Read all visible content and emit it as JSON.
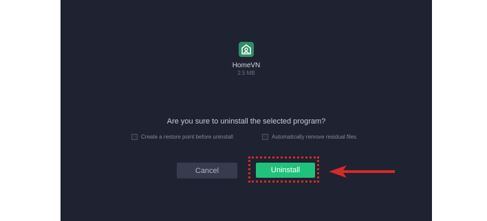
{
  "app": {
    "name": "HomeVN",
    "size": "2.5 MB",
    "icon": "app-house-icon",
    "icon_color": "#2e8f67"
  },
  "dialog": {
    "question": "Are you sure to uninstall the selected program?",
    "options": [
      {
        "label": "Create a restore point before uninstall",
        "checked": false
      },
      {
        "label": "Automatically remove residual files",
        "checked": false
      }
    ]
  },
  "buttons": {
    "cancel_label": "Cancel",
    "uninstall_label": "Uninstall"
  },
  "colors": {
    "dialog_bg": "#1f2230",
    "primary": "#20c27b",
    "cancel_bg": "#363b4d",
    "annotation": "#d42a2a"
  }
}
